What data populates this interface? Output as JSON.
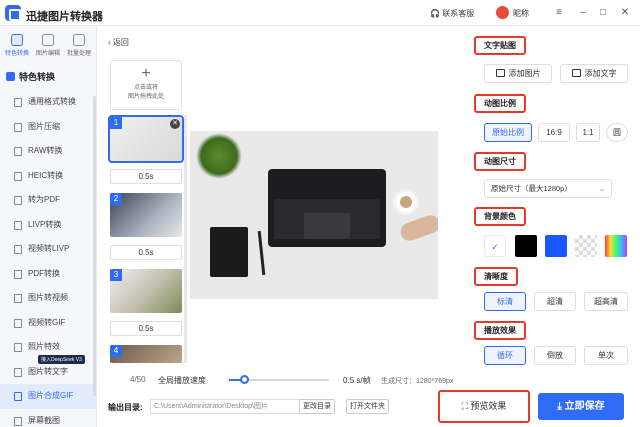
{
  "app": {
    "title": "迅捷图片转换器"
  },
  "titlebar": {
    "support": "联系客服",
    "username": "昵称",
    "minimize": "–",
    "maximize": "□",
    "close": "✕",
    "menu": "≡"
  },
  "rail_tabs": [
    {
      "label": "特色转换"
    },
    {
      "label": "图片编辑"
    },
    {
      "label": "批量处理"
    }
  ],
  "section": {
    "title": "特色转换"
  },
  "nav": [
    {
      "label": "通用格式转换"
    },
    {
      "label": "图片压缩"
    },
    {
      "label": "RAW转换"
    },
    {
      "label": "HEIC转换"
    },
    {
      "label": "转为PDF"
    },
    {
      "label": "LIVP转换"
    },
    {
      "label": "视频转LIVP"
    },
    {
      "label": "PDF转换"
    },
    {
      "label": "图片转视频"
    },
    {
      "label": "视频转GIF"
    },
    {
      "label": "照片特效"
    },
    {
      "label": "图片转文字"
    },
    {
      "label": "图片合成GIF"
    },
    {
      "label": "屏幕截图"
    }
  ],
  "badge": {
    "text": "接入DeepSeek V3"
  },
  "editor": {
    "back": "返回",
    "add_hint1": "点击或将",
    "add_hint2": "图片拖拽此处",
    "frames": [
      {
        "num": "1",
        "duration": "0.5s"
      },
      {
        "num": "2",
        "duration": "0.5s"
      },
      {
        "num": "3",
        "duration": "0.5s"
      },
      {
        "num": "4",
        "duration": ""
      }
    ]
  },
  "playback": {
    "counter": "4/50",
    "speed_label": "全局播放速度",
    "speed_value": "0.5 s/帧",
    "speed_fraction": 0.15,
    "gen_size": "生成尺寸：1280*769px"
  },
  "output": {
    "label": "输出目录:",
    "path": "C:\\Users\\Administrator\\Desktop\\图片",
    "change": "更改目录",
    "open": "打开文件夹"
  },
  "settings": {
    "text_sticker": {
      "title": "文字贴图",
      "add_image": "添加图片",
      "add_text": "添加文字"
    },
    "ratio": {
      "title": "动图比例",
      "options": [
        "原始比例",
        "16:9",
        "1:1",
        "圆"
      ],
      "selected": "原始比例"
    },
    "size": {
      "title": "动图尺寸",
      "value": "原始尺寸（最大1280p）"
    },
    "bg_color": {
      "title": "背景颜色",
      "colors": [
        "#ffffff",
        "#000000",
        "#1a56ff",
        "transparent",
        "gradient"
      ]
    },
    "clarity": {
      "title": "清晰度",
      "options": [
        "标清",
        "超清",
        "超高清"
      ],
      "selected": "标清"
    },
    "play_effect": {
      "title": "播放效果",
      "options": [
        "循环",
        "倒放",
        "单次"
      ],
      "selected": "循环"
    }
  },
  "actions": {
    "preview": "预览效果",
    "save": "立即保存"
  },
  "colors": {
    "accent": "#2f6bf5",
    "highlight": "#e23b2b"
  }
}
